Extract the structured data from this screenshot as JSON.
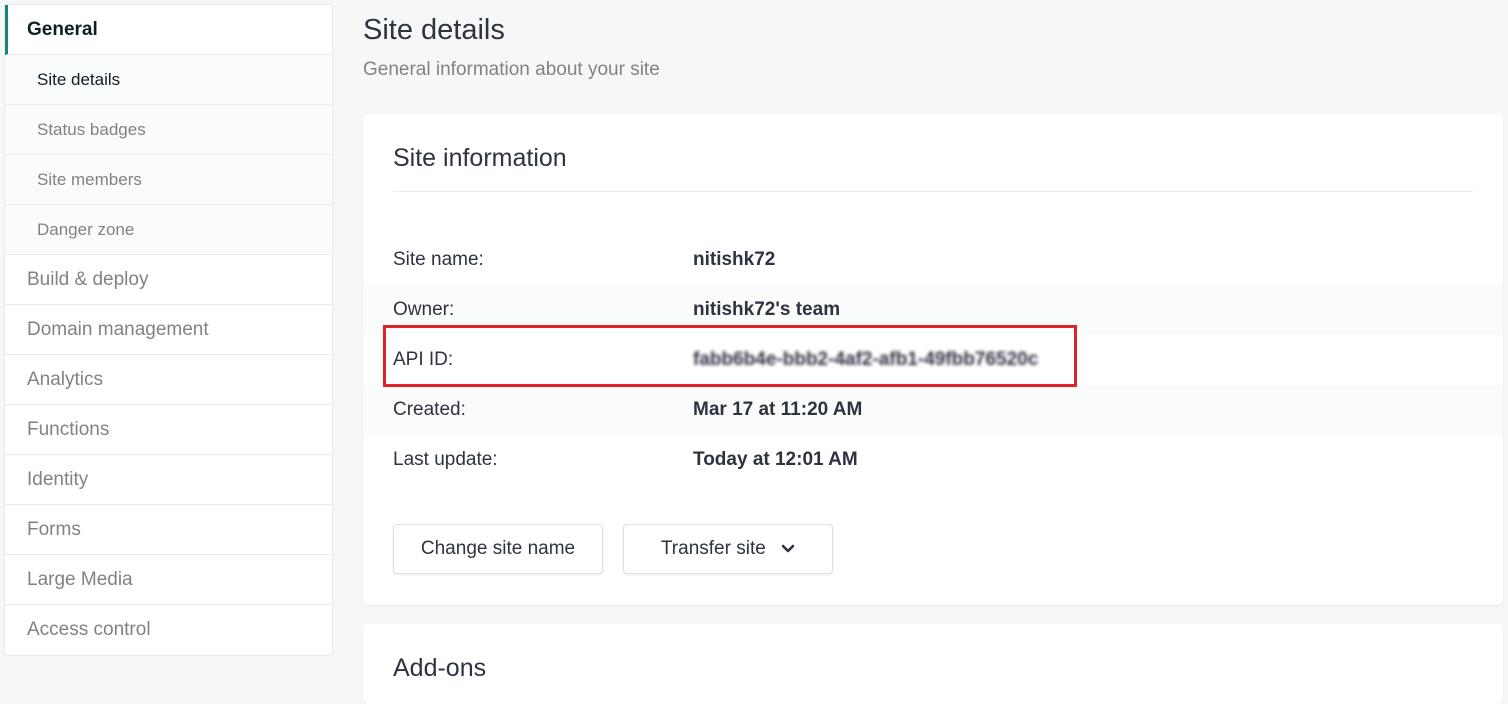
{
  "sidebar": {
    "general_label": "General",
    "subitems": [
      "Site details",
      "Status badges",
      "Site members",
      "Danger zone"
    ],
    "items": [
      "Build & deploy",
      "Domain management",
      "Analytics",
      "Functions",
      "Identity",
      "Forms",
      "Large Media",
      "Access control"
    ]
  },
  "page": {
    "title": "Site details",
    "subtitle": "General information about your site"
  },
  "site_info": {
    "title": "Site information",
    "rows": [
      {
        "label": "Site name:",
        "value": "nitishk72"
      },
      {
        "label": "Owner:",
        "value": "nitishk72's team"
      },
      {
        "label": "API ID:",
        "value": "fabb6b4e-bbb2-4af2-afb1-49fbb76520c"
      },
      {
        "label": "Created:",
        "value": "Mar 17 at 11:20 AM"
      },
      {
        "label": "Last update:",
        "value": "Today at 12:01 AM"
      }
    ],
    "change_button": "Change site name",
    "transfer_button": "Transfer site"
  },
  "addons": {
    "title": "Add-ons"
  },
  "colors": {
    "accent": "#15847d",
    "highlight": "#e0222a"
  }
}
